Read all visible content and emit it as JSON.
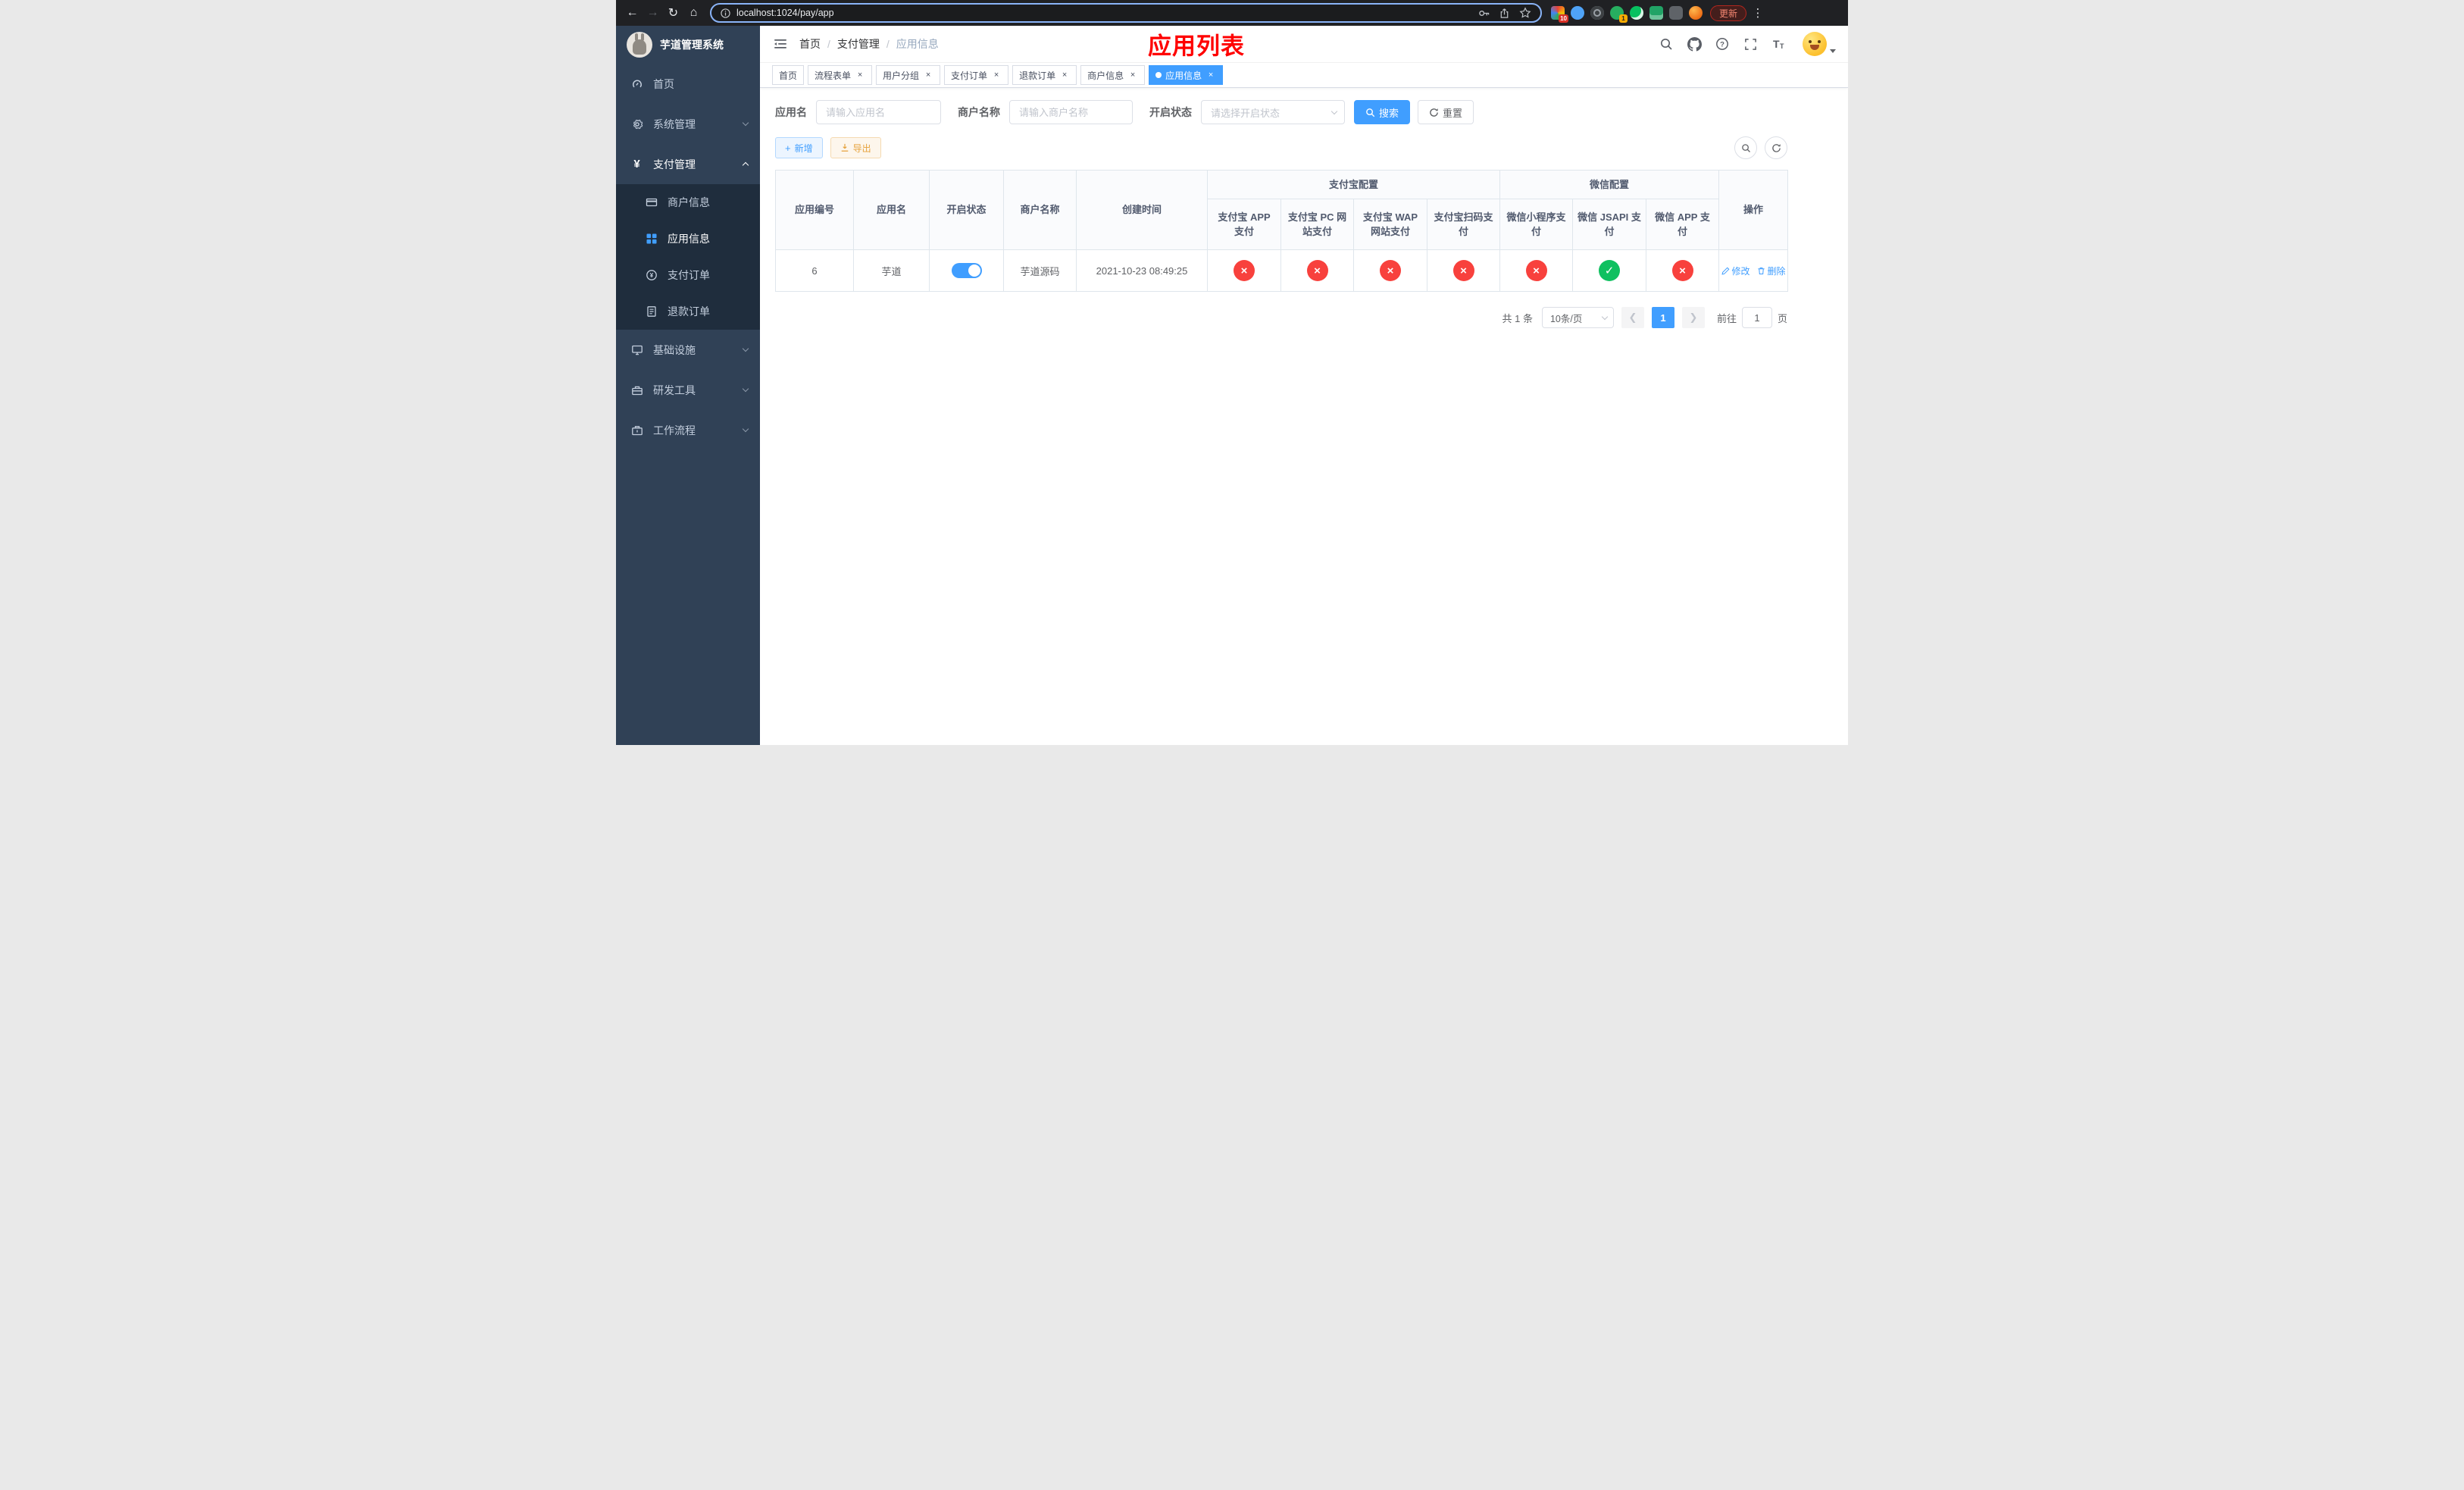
{
  "colors": {
    "accent": "#409EFF",
    "success_circle": "#10c060",
    "danger_circle": "#f8413d",
    "warning": "#e6a23c",
    "sidebar_bg": "#304156",
    "sidebar_submenu_bg": "#1f2d3d",
    "annotation_red": "#ff0000",
    "active_tab": "#409EFF"
  },
  "browser": {
    "url": "localhost:1024/pay/app",
    "update_button": "更新",
    "ext_badge_colorful": "10",
    "ext_badge_green": "1"
  },
  "app": {
    "logo_title": "芋道管理系统",
    "annotation_title": "应用列表"
  },
  "sidebar": {
    "items": [
      {
        "label": "首页"
      },
      {
        "label": "系统管理"
      },
      {
        "label": "支付管理"
      },
      {
        "label": "基础设施"
      },
      {
        "label": "研发工具"
      },
      {
        "label": "工作流程"
      }
    ],
    "pay_submenu": [
      {
        "label": "商户信息"
      },
      {
        "label": "应用信息"
      },
      {
        "label": "支付订单"
      },
      {
        "label": "退款订单"
      }
    ]
  },
  "breadcrumb": {
    "items": [
      {
        "label": "首页"
      },
      {
        "label": "支付管理"
      },
      {
        "label": "应用信息"
      }
    ]
  },
  "tabs": [
    {
      "label": "首页"
    },
    {
      "label": "流程表单"
    },
    {
      "label": "用户分组"
    },
    {
      "label": "支付订单"
    },
    {
      "label": "退款订单"
    },
    {
      "label": "商户信息"
    },
    {
      "label": "应用信息"
    }
  ],
  "filters": {
    "app_name_label": "应用名",
    "app_name_placeholder": "请输入应用名",
    "merchant_label": "商户名称",
    "merchant_placeholder": "请输入商户名称",
    "status_label": "开启状态",
    "status_placeholder": "请选择开启状态",
    "search_button": "搜索",
    "reset_button": "重置"
  },
  "toolbar": {
    "add_button": "新增",
    "export_button": "导出"
  },
  "table": {
    "headers": {
      "app_id": "应用编号",
      "app_name": "应用名",
      "status": "开启状态",
      "merchant": "商户名称",
      "created": "创建时间",
      "alipay_group": "支付宝配置",
      "wechat_group": "微信配置",
      "alipay_app": "支付宝 APP 支付",
      "alipay_pc": "支付宝 PC 网站支付",
      "alipay_wap": "支付宝 WAP 网站支付",
      "alipay_qr": "支付宝扫码支付",
      "wx_mini": "微信小程序支付",
      "wx_jsapi": "微信 JSAPI 支付",
      "wx_app": "微信 APP 支付",
      "actions": "操作"
    },
    "rows": [
      {
        "app_id": "6",
        "app_name": "芋道",
        "status_on": true,
        "merchant": "芋道源码",
        "created": "2021-10-23 08:49:25",
        "alipay_app": false,
        "alipay_pc": false,
        "alipay_wap": false,
        "alipay_qr": false,
        "wx_mini": false,
        "wx_jsapi": true,
        "wx_app": false,
        "edit_label": "修改",
        "delete_label": "删除"
      }
    ]
  },
  "pagination": {
    "total_text": "共 1 条",
    "page_size_text": "10条/页",
    "current_page": "1",
    "goto_label": "前往",
    "goto_value": "1",
    "page_unit": "页"
  }
}
